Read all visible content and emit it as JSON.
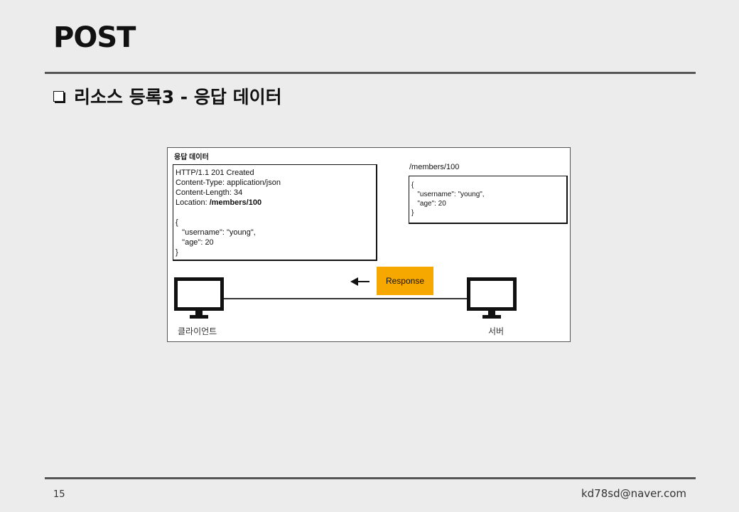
{
  "slide": {
    "title": "POST",
    "subtitle": "리소스 등록3 - 응답 데이터",
    "page_number": "15",
    "author_email": "kd78sd@naver.com"
  },
  "figure": {
    "caption": "응답 데이터",
    "http_message": {
      "status_line": "HTTP/1.1 201 Created",
      "content_type": "Content-Type: application/json",
      "content_length": "Content-Length: 34",
      "location_key": "Location: ",
      "location_value": "/members/100",
      "body_open": "{",
      "body_username": "   \"username\": \"young\",",
      "body_age": "   \"age\": 20",
      "body_close": "}"
    },
    "resource": {
      "path": "/members/100",
      "body_open": "{",
      "body_username": "   \"username\": \"young\",",
      "body_age": "   \"age\": 20",
      "body_close": "}"
    },
    "response_label": "Response",
    "response_color": "#f6a800",
    "client_label": "클라이언트",
    "server_label": "서버",
    "client_icon": "computer-icon",
    "server_icon": "computer-icon",
    "arrow_icon": "arrow-left-icon"
  }
}
